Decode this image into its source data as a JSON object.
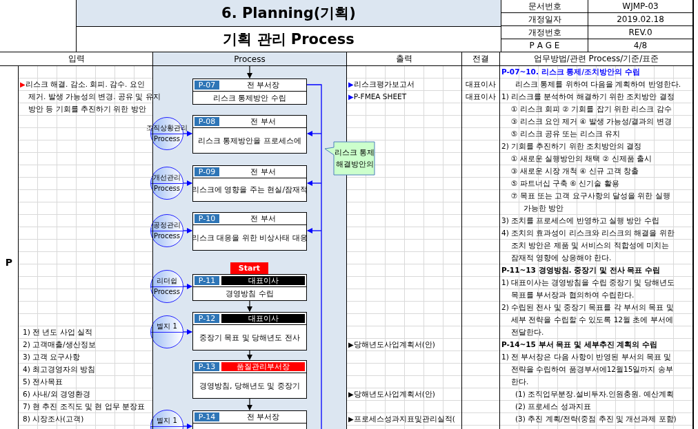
{
  "header": {
    "title": "6. Planning(기획)",
    "subtitle": "기획 관리 Process",
    "doc_info": [
      {
        "label": "문서번호",
        "value": "WJMP-03"
      },
      {
        "label": "개정일자",
        "value": "2019.02.18"
      },
      {
        "label": "개정번호",
        "value": "REV.0"
      },
      {
        "label": "P A G E",
        "value": "4/8"
      }
    ]
  },
  "columns": [
    "입력",
    "Process",
    "출력",
    "전결",
    "업무방법/관련 Process/기준/표준"
  ],
  "phase": "P",
  "inputs": [
    {
      "marker": "▶",
      "color": "#ff0000",
      "lines": [
        "리스크 해결. 감소. 회피. 감수. 요인",
        "제거. 발생 가능성의 변경. 공유 및 유지",
        "방안 등 기회를 추진하기 위한 방안"
      ]
    },
    {
      "lines": [
        "1) 전 년도 사업 실적",
        "2) 고객매출/생산정보",
        "3) 고객 요구사항",
        "4) 최고경영자의 방침",
        "5) 전사목표",
        "6) 사내/외 경영환경",
        "7) 현 추진 조직도 및 현 업무 분장표",
        "8) 시장조사(고객)"
      ]
    }
  ],
  "steps": [
    {
      "code": "P-07",
      "owner": "전 부서장",
      "color": "#ffffff",
      "title": "리스크 통제방안 수립",
      "entry_arrow": true,
      "feedback": false
    },
    {
      "code": "P-08",
      "owner": "전 부서",
      "color": "#ffffff",
      "title": "리스크 통제방안을 프로세스에",
      "entry_arrow": false,
      "feedback": true,
      "input": {
        "label": "조직상황관리",
        "sub": "Process"
      }
    },
    {
      "code": "P-09",
      "owner": "전 부서",
      "color": "#ffffff",
      "title": "리스크에 영향을 주는 현실/잠재적",
      "entry_arrow": false,
      "feedback": true,
      "input": {
        "label": "개선관리",
        "sub": "Process"
      }
    },
    {
      "code": "P-10",
      "owner": "전 부서",
      "color": "#ffffff",
      "title": "리스크 대응을 위한 비상사태 대응",
      "entry_arrow": false,
      "feedback": true,
      "input": {
        "label": "공정관리",
        "sub": "Process"
      }
    },
    {
      "code": "P-11",
      "owner": "대표이사",
      "color": "#000000",
      "title": "경영방침 수립",
      "badge": "Start",
      "input": {
        "label": "리더쉽",
        "sub": "Process"
      }
    },
    {
      "code": "P-12",
      "owner": "대표이사",
      "color": "#000000",
      "title": "중장기 목표 및 당해년도 전사",
      "entry_arrow": true,
      "feedback": false,
      "input": {
        "label": "별지 1"
      }
    },
    {
      "code": "P-13",
      "owner": "품질관리부서장",
      "color": "#ff0000",
      "title": "경영방침, 당해년도 및 중장기",
      "entry_arrow": true,
      "feedback": false
    },
    {
      "code": "P-14",
      "owner": "전 부서장",
      "color": "#ffffff",
      "entry_arrow": true,
      "feedback": false,
      "input": {
        "label": "별지 1"
      }
    }
  ],
  "callout": [
    "리스크 통제",
    "해결방안의"
  ],
  "outputs": [
    {
      "marker": "▶",
      "color": "#0000ff",
      "text": "리스크평가보고서",
      "approval": "대표이사"
    },
    {
      "marker": "▶",
      "color": "#0000ff",
      "text": "P-FMEA SHEET",
      "approval": "대표이사"
    },
    {
      "marker": "▶",
      "color": "#000000",
      "text": "당해년도사업계획서(안)"
    },
    {
      "marker": "▶",
      "color": "#000000",
      "text": "당해년도사업계획서(안)"
    },
    {
      "marker": "▶",
      "color": "#000000",
      "text": "프로세스성과지표및관리실적("
    }
  ],
  "methods": [
    {
      "kind": "heading",
      "color": "#0000ff",
      "text": "P-07~10. 리스크 통제/조치방안의 수립"
    },
    {
      "kind": "lead",
      "text": "리스크 통제를 위하여 다음을 계획하여 반영한다."
    },
    {
      "kind": "text",
      "text": "1) 리스크를 분석하여 해결하기 위한 조치방안 결정"
    },
    {
      "kind": "item",
      "text": "① 리스크 회피 ② 기회를 잡기 위한 리스크 감수"
    },
    {
      "kind": "item",
      "text": "③ 리스크 요인 제거 ④ 발생 가능성/결과의 변경"
    },
    {
      "kind": "item",
      "text": "⑤ 리스크 공유 또는 리스크 유지"
    },
    {
      "kind": "text",
      "text": "2) 기회를 추진하기 위한 조치방안의 결정"
    },
    {
      "kind": "item",
      "text": "① 새로운 실행방안의 채택 ② 신제품 출시"
    },
    {
      "kind": "item",
      "text": "③ 새로운 시장 개척 ④ 신규 고객 창출"
    },
    {
      "kind": "item",
      "text": "⑤ 파트너십 구축 ⑥ 신기술 활용"
    },
    {
      "kind": "item",
      "text": "⑦ 목표 또는 고객 요구사항의 달성을 위한 실행"
    },
    {
      "kind": "cont2",
      "text": "가능한 방안"
    },
    {
      "kind": "text",
      "text": "3) 조치를 프로세스에 반영하고 실행 방안 수립"
    },
    {
      "kind": "text",
      "text": "4) 조치의 효과성이 리스크와 리스크의 해결을 위한"
    },
    {
      "kind": "item",
      "text": "조치 방안은 제품 및 서비스의 적합성에 미치는"
    },
    {
      "kind": "item",
      "text": "잠재적 영향에 상응해야 한다."
    },
    {
      "kind": "heading",
      "color": "#000000",
      "text": "P-11~13 경영방침. 중장기 및 전사 목표 수립"
    },
    {
      "kind": "text",
      "text": "1) 대표이사는 경영방침을 수립 중장기 및 당해년도"
    },
    {
      "kind": "item",
      "text": "목표를 부서장과 협의하여 수립한다."
    },
    {
      "kind": "text",
      "text": "2) 수립된 전사 및 중장기 목표를 각 부서의 목표 및"
    },
    {
      "kind": "item",
      "text": "세부 전략을 수립할 수 있도록 12월 초에 부서에"
    },
    {
      "kind": "item",
      "text": "전달한다."
    },
    {
      "kind": "heading",
      "color": "#000000",
      "text": "P-14~15 부서 목표 및 세부추진 계획의 수립"
    },
    {
      "kind": "text",
      "text": "1) 전 부서장은 다음 사항이 반영된 부서의 목표 및"
    },
    {
      "kind": "item",
      "text": "전략을 수립하여 품경부서에12월15일까지 송부"
    },
    {
      "kind": "item",
      "text": "한다."
    },
    {
      "kind": "sub",
      "text": "(1) 조직업무분장.설비투자.인원충원. 예산계획"
    },
    {
      "kind": "sub",
      "text": "(2) 프로세스 성과지표"
    },
    {
      "kind": "sub",
      "text": "(3) 추진 계획/전략(중점 추진 및 개선과제 포함)"
    }
  ]
}
